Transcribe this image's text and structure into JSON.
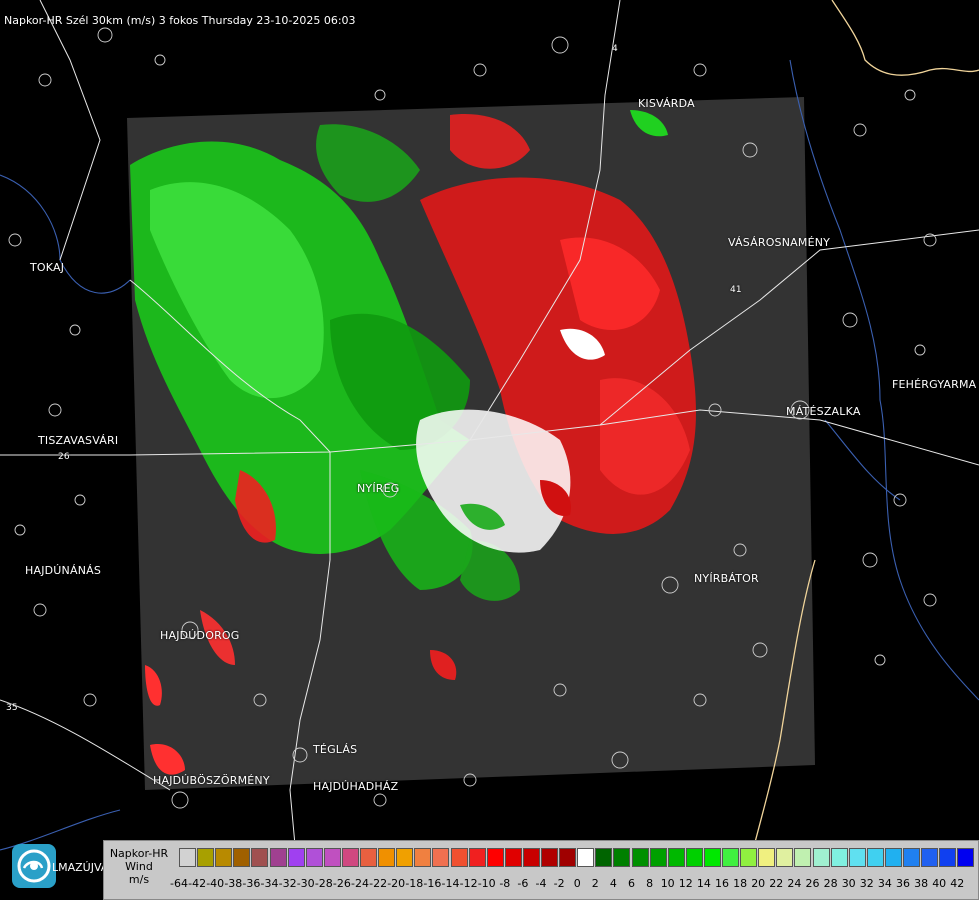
{
  "header": {
    "title": "Napkor-HR Szél 30km (m/s) 3 fokos Thursday 23-10-2025 06:03"
  },
  "cities": {
    "kisvarda": "KISVÁRDA",
    "tokaj": "TOKAJ",
    "vasarosnameny": "VÁSÁROSNAMÉNY",
    "fehergyarmat": "FEHÉRGYARMA",
    "mateszalka": "MÁTÉSZALKA",
    "tiszavasvari": "TISZAVASVÁRI",
    "nyiregyhaza": "NYÍREG",
    "hajdunanas": "HAJDÚNÁNÁS",
    "nyirbator": "NYÍRBÁTOR",
    "hajdudorog": "HAJDÚDOROG",
    "teglas": "TÉGLÁS",
    "hajduboszormeny": "HAJDÚBÖSZÖRMÉNY",
    "hajduhadhaz": "HAJDÚHADHÁZ",
    "balmazujvaros": "LMAZÚJVÁR"
  },
  "road_labels": {
    "r26": "26",
    "r35": "35",
    "r41": "41",
    "r4": "4"
  },
  "legend": {
    "line1": "Napkor-HR",
    "line2": "Wind",
    "line3": "m/s",
    "ticks": [
      "-64",
      "-42",
      "-40",
      "-38",
      "-36",
      "-34",
      "-32",
      "-30",
      "-28",
      "-26",
      "-24",
      "-22",
      "-20",
      "-18",
      "-16",
      "-14",
      "-12",
      "-10",
      "-8",
      "-6",
      "-4",
      "-2",
      "0",
      "2",
      "4",
      "6",
      "8",
      "10",
      "12",
      "14",
      "16",
      "18",
      "20",
      "22",
      "24",
      "26",
      "28",
      "30",
      "32",
      "34",
      "36",
      "38",
      "40",
      "42"
    ],
    "colors": [
      "#d2d2d2",
      "#a8a000",
      "#b88a00",
      "#a06000",
      "#a05050",
      "#a04090",
      "#a040f0",
      "#b050d8",
      "#c050c0",
      "#d04880",
      "#e86040",
      "#f09000",
      "#f0a000",
      "#f08040",
      "#f07050",
      "#f05030",
      "#f02020",
      "#ff0000",
      "#e00000",
      "#c80000",
      "#b00000",
      "#a00000",
      "#ffffff",
      "#006400",
      "#008000",
      "#009000",
      "#00a000",
      "#00b800",
      "#00d000",
      "#00e800",
      "#40f040",
      "#90f040",
      "#f0f080",
      "#e0f0a0",
      "#c0f0b0",
      "#a0f0d0",
      "#80f0e0",
      "#60e0f0",
      "#40d0f0",
      "#20b0f0",
      "#2080f0",
      "#2060f0",
      "#1040f0",
      "#0000f0"
    ]
  }
}
